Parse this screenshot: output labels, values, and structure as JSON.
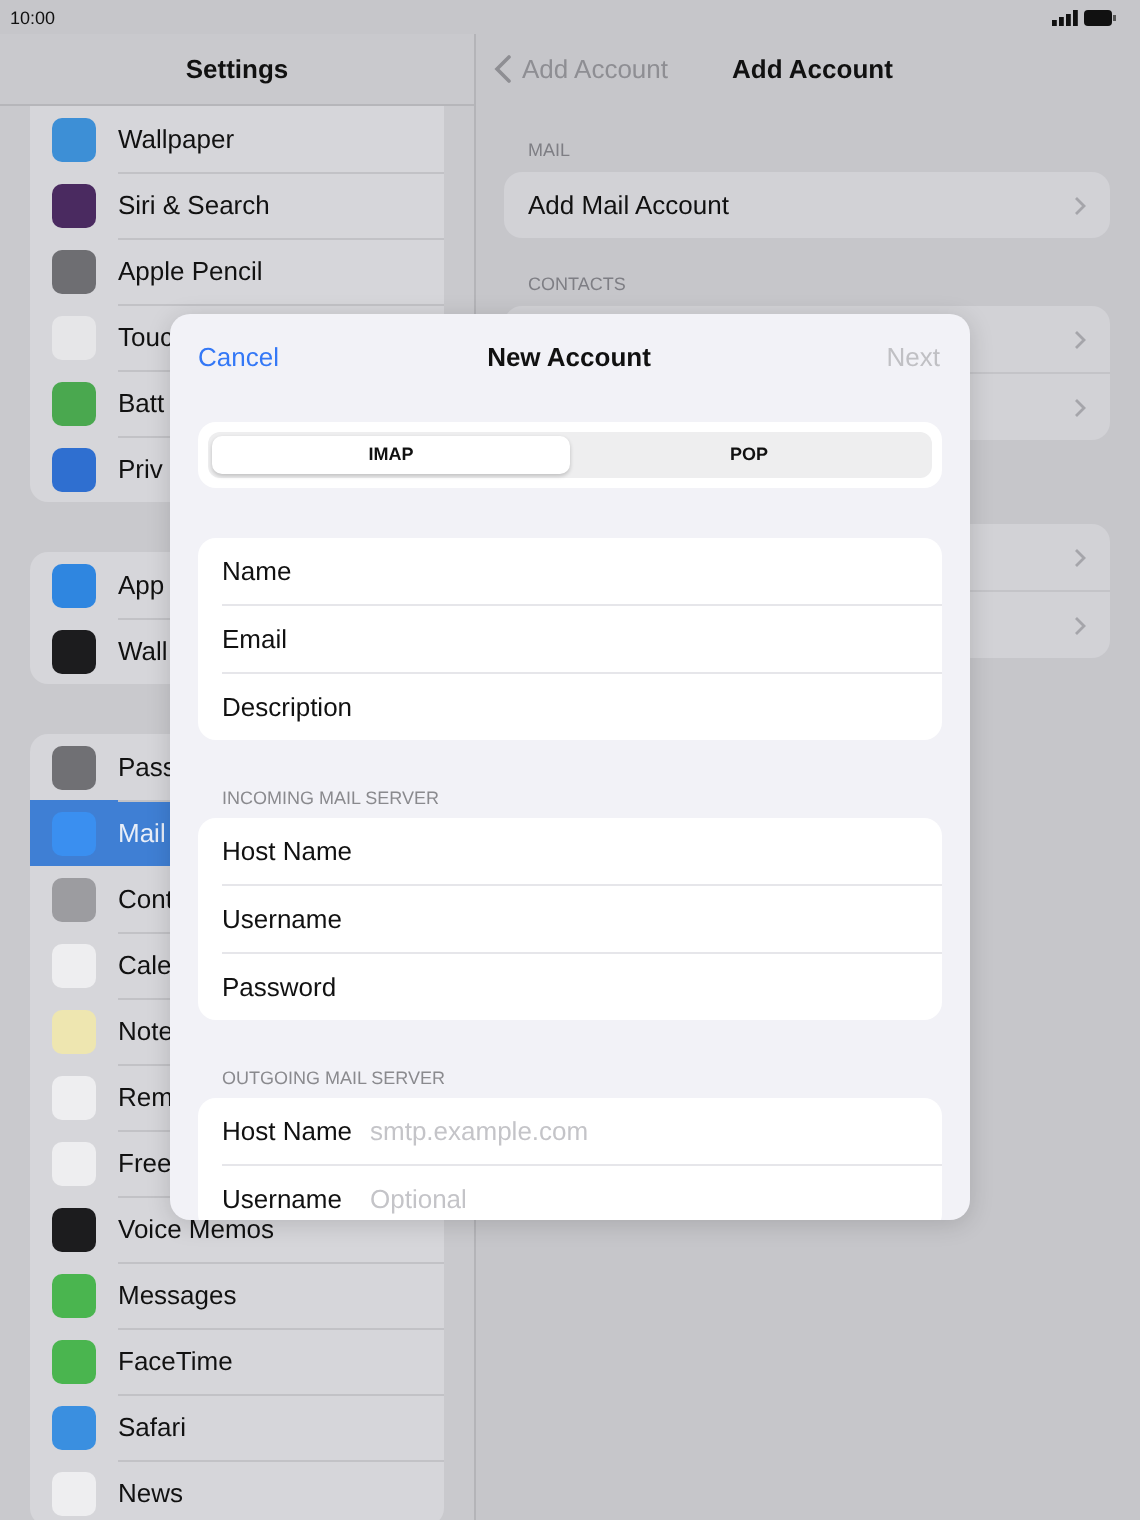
{
  "status_bar": {
    "time": "10:00"
  },
  "sidebar": {
    "title": "Settings",
    "groups": [
      {
        "items": [
          {
            "label": "Wallpaper",
            "color": "#3d8fd6",
            "selected": false
          },
          {
            "label": "Siri & Search",
            "color": "#4a2a60",
            "selected": false
          },
          {
            "label": "Apple Pencil",
            "color": "#6e6e72",
            "selected": false
          },
          {
            "label": "Touc",
            "color": "#e6e6e8",
            "selected": false
          },
          {
            "label": "Batt",
            "color": "#4aa84f",
            "selected": false
          },
          {
            "label": "Priv",
            "color": "#2f6fd0",
            "selected": false
          }
        ]
      },
      {
        "items": [
          {
            "label": "App",
            "color": "#2f86e0",
            "selected": false
          },
          {
            "label": "Wall",
            "color": "#1c1c1e",
            "selected": false
          }
        ]
      },
      {
        "items": [
          {
            "label": "Pass",
            "color": "#707074",
            "selected": false
          },
          {
            "label": "Mail",
            "color": "#3a8ff0",
            "selected": true
          },
          {
            "label": "Cont",
            "color": "#9c9ca0",
            "selected": false
          },
          {
            "label": "Cale",
            "color": "#eeeef0",
            "selected": false
          },
          {
            "label": "Note",
            "color": "#eee6b0",
            "selected": false
          },
          {
            "label": "Rem",
            "color": "#eeeef0",
            "selected": false
          },
          {
            "label": "Free",
            "color": "#eeeef0",
            "selected": false
          },
          {
            "label": "Voice Memos",
            "color": "#1c1c1e",
            "selected": false
          },
          {
            "label": "Messages",
            "color": "#4ab54f",
            "selected": false
          },
          {
            "label": "FaceTime",
            "color": "#4ab54f",
            "selected": false
          },
          {
            "label": "Safari",
            "color": "#3a8fe0",
            "selected": false
          },
          {
            "label": "News",
            "color": "#eeeef0",
            "selected": false
          }
        ]
      }
    ]
  },
  "detail": {
    "back": "Add Account",
    "title": "Add Account",
    "sections": [
      {
        "header": "MAIL",
        "rows": [
          {
            "kind": "label",
            "label": "Add Mail Account"
          }
        ]
      },
      {
        "header": "CONTACTS",
        "rows": [
          {
            "kind": "hidden"
          },
          {
            "kind": "hidden"
          }
        ]
      },
      {
        "rows": [
          {
            "kind": "hidden"
          },
          {
            "kind": "hidden"
          }
        ]
      }
    ]
  },
  "modal": {
    "cancel": "Cancel",
    "title": "New Account",
    "next": {
      "label": "Next",
      "disabled": true
    },
    "segments": [
      {
        "label": "IMAP",
        "selected": true
      },
      {
        "label": "POP",
        "selected": false
      }
    ],
    "groups": [
      {
        "fields": [
          {
            "label": "Name"
          },
          {
            "label": "Email"
          },
          {
            "label": "Description"
          }
        ]
      },
      {
        "header": "INCOMING MAIL SERVER",
        "fields": [
          {
            "label": "Host Name"
          },
          {
            "label": "Username"
          },
          {
            "label": "Password"
          }
        ]
      },
      {
        "header": "OUTGOING MAIL SERVER",
        "fields": [
          {
            "label": "Host Name",
            "placeholder": "smtp.example.com"
          },
          {
            "label": "Username",
            "placeholder": "Optional"
          }
        ]
      }
    ]
  }
}
